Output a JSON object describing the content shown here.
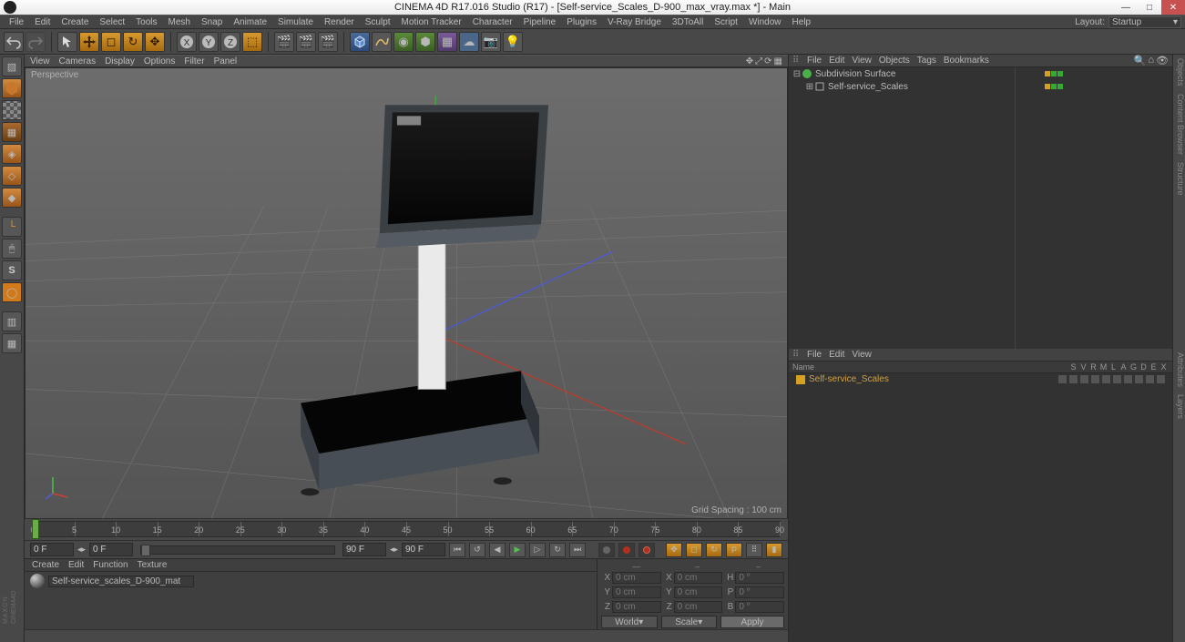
{
  "title": "CINEMA 4D R17.016 Studio (R17) - [Self-service_Scales_D-900_max_vray.max *] - Main",
  "menu": [
    "File",
    "Edit",
    "Create",
    "Select",
    "Tools",
    "Mesh",
    "Snap",
    "Animate",
    "Simulate",
    "Render",
    "Sculpt",
    "Motion Tracker",
    "Character",
    "Pipeline",
    "Plugins",
    "Script",
    "Window",
    "Help"
  ],
  "layout_label": "Layout:",
  "layout_value": "Startup",
  "vray_menu": "V-Ray Bridge",
  "threed_menu": "3DToAll",
  "viewport_menu": [
    "View",
    "Cameras",
    "Display",
    "Options",
    "Filter",
    "Panel"
  ],
  "viewport_name": "Perspective",
  "grid_spacing": "Grid Spacing : 100 cm",
  "timeline": {
    "start": 0,
    "end": 90,
    "ticks": [
      0,
      5,
      10,
      15,
      20,
      25,
      30,
      35,
      40,
      45,
      50,
      55,
      60,
      65,
      70,
      75,
      80,
      85,
      90
    ]
  },
  "playback": {
    "cur_frame": "0 F",
    "start_field": "0 F",
    "end_display": "90 F",
    "end_field": "90 F"
  },
  "mat_menu": [
    "Create",
    "Edit",
    "Function",
    "Texture"
  ],
  "material_name": "Self-service_scales_D-900_mat",
  "coord": {
    "header": [
      "—",
      "–",
      "–"
    ],
    "rows": [
      {
        "l": "X",
        "v1": "0 cm",
        "l2": "X",
        "v2": "0 cm",
        "l3": "H",
        "v3": "0 °"
      },
      {
        "l": "Y",
        "v1": "0 cm",
        "l2": "Y",
        "v2": "0 cm",
        "l3": "P",
        "v3": "0 °"
      },
      {
        "l": "Z",
        "v1": "0 cm",
        "l2": "Z",
        "v2": "0 cm",
        "l3": "B",
        "v3": "0 °"
      }
    ],
    "sel1": "World",
    "sel2": "Scale",
    "apply": "Apply"
  },
  "obj_menu": [
    "File",
    "Edit",
    "View",
    "Objects",
    "Tags",
    "Bookmarks"
  ],
  "objects": [
    {
      "name": "Subdivision Surface",
      "indent": 0,
      "icon": "subdiv"
    },
    {
      "name": "Self-service_Scales",
      "indent": 1,
      "icon": "null"
    }
  ],
  "layer_menu": [
    "File",
    "Edit",
    "View"
  ],
  "layer_cols": [
    "Name",
    "S",
    "V",
    "R",
    "M",
    "L",
    "A",
    "G",
    "D",
    "E",
    "X"
  ],
  "layer_name": "Self-service_Scales",
  "right_tabs_top": [
    "Objects",
    "Content Browser",
    "Structure"
  ],
  "right_tabs_bot": [
    "Attributes",
    "Layers"
  ],
  "brand": "MAXON\nCINEMA 4D"
}
